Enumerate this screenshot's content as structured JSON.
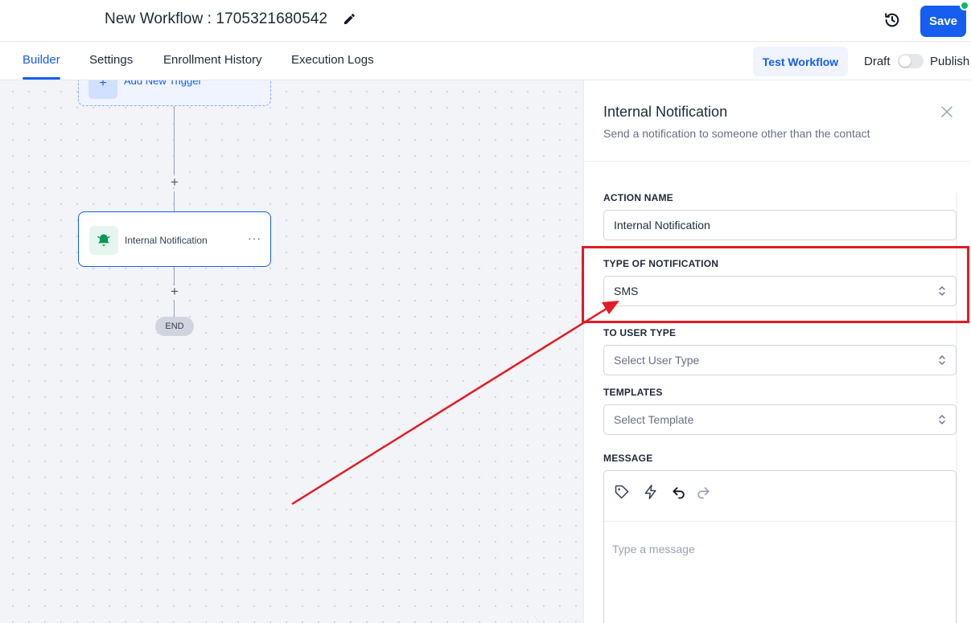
{
  "header": {
    "workflow_title": "New Workflow : 1705321680542",
    "save_label": "Save"
  },
  "tabs": [
    {
      "label": "Builder",
      "active": true
    },
    {
      "label": "Settings",
      "active": false
    },
    {
      "label": "Enrollment History",
      "active": false
    },
    {
      "label": "Execution Logs",
      "active": false
    }
  ],
  "toolbar": {
    "test_workflow_label": "Test Workflow",
    "draft_label": "Draft",
    "publish_label": "Publish",
    "published": false
  },
  "canvas": {
    "trigger_label": "Add New Trigger",
    "action_node_label": "Internal Notification",
    "plus_symbol": "+",
    "more_symbol": "···",
    "end_label": "END"
  },
  "panel": {
    "title": "Internal Notification",
    "subtitle": "Send a notification to someone other than the contact",
    "fields": {
      "action_name": {
        "label": "ACTION NAME",
        "value": "Internal Notification"
      },
      "notification_type": {
        "label": "TYPE OF NOTIFICATION",
        "value": "SMS"
      },
      "user_type": {
        "label": "TO USER TYPE",
        "placeholder": "Select User Type"
      },
      "templates": {
        "label": "TEMPLATES",
        "placeholder": "Select Template"
      },
      "message": {
        "label": "MESSAGE",
        "placeholder": "Type a message"
      }
    }
  },
  "colors": {
    "accent": "#155eef",
    "annotation_red": "#e31b23",
    "status_online": "#12b76a"
  },
  "icons": [
    "pencil-icon",
    "history-icon",
    "bell-icon",
    "close-icon",
    "tag-icon",
    "bolt-icon",
    "undo-icon",
    "redo-icon",
    "select-arrows-icon"
  ]
}
